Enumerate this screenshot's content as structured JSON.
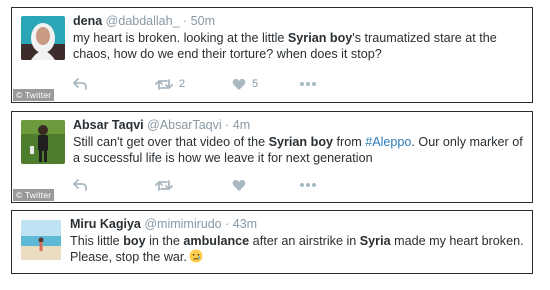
{
  "watermark": "© Twitter",
  "colors": {
    "hashtag": "#2b7bb9",
    "meta": "#8899a6",
    "icon": "#aab8c2"
  },
  "tweets": [
    {
      "name": "dena",
      "handle": "@dabdallah_",
      "dot": "·",
      "time": "50m",
      "text_parts": [
        "my heart is broken. looking at the little ",
        "Syrian boy",
        "'s traumatized stare at the chaos, how do we end their torture? when does it stop?"
      ],
      "retweet_count": "2",
      "like_count": "5",
      "icons": [
        "reply-icon",
        "retweet-icon",
        "like-icon",
        "more-icon"
      ]
    },
    {
      "name": "Absar Taqvi",
      "handle": "@AbsarTaqvi",
      "dot": "·",
      "time": "4m",
      "text_parts": [
        "Still can't get over that video of the ",
        "Syrian boy",
        " from ",
        "#Aleppo",
        ". Our only marker of a successful life is how we leave it for next generation"
      ],
      "icons": [
        "reply-icon",
        "retweet-icon",
        "like-icon",
        "more-icon"
      ]
    },
    {
      "name": "Miru Kagiya",
      "handle": "@mimimirudo",
      "dot": "·",
      "time": "43m",
      "text_parts": [
        "This little ",
        "boy",
        " in the ",
        "ambulance",
        " after an airstrike in ",
        "Syria",
        " made my heart broken. Please, stop the war."
      ],
      "icons": [
        "crying-face-emoji"
      ]
    }
  ]
}
